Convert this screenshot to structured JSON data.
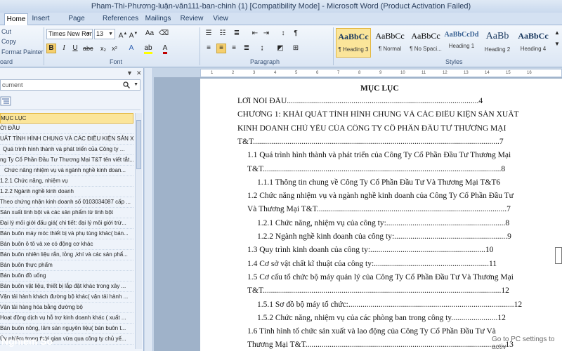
{
  "window": {
    "title": "Pham-Thi-Phương-luận-văn111-ban-chinh (1) [Compatibility Mode]  -  Microsoft Word (Product Activation Failed)"
  },
  "tabs": [
    "Home",
    "Insert",
    "Page Layout",
    "References",
    "Mailings",
    "Review",
    "View"
  ],
  "ribbon": {
    "clipboard": {
      "cut": "Cut",
      "copy": "Copy",
      "format_painter": "Format Painter",
      "label": "oard"
    },
    "font": {
      "name": "Times New Roma",
      "size": "13",
      "label": "Font"
    },
    "paragraph": {
      "label": "Paragraph"
    },
    "styles": {
      "label": "Styles",
      "items": [
        {
          "preview": "AaBbCc",
          "name": "¶ Heading 3"
        },
        {
          "preview": "AaBbCc",
          "name": "¶ Normal"
        },
        {
          "preview": "AaBbCc",
          "name": "¶ No Spaci..."
        },
        {
          "preview": "AaBbCcDd",
          "name": "Heading 1"
        },
        {
          "preview": "AaBb",
          "name": "Heading 2"
        },
        {
          "preview": "AaBbCc",
          "name": "Heading 4"
        }
      ]
    }
  },
  "nav": {
    "search_placeholder": "cument",
    "items": [
      "MỤC LỤC",
      "ỜI ĐẦU",
      "UẤT TÌNH HÌNH CHUNG VÀ CÁC ĐIỀU KIỆN SẢN X...",
      "Quá trình hình thành và phát triển của Công ty ...",
      "ng Ty Cổ Phần Đầu Tư Thương Mại T&T tên viết tắt...",
      "Chức năng nhiệm vụ và ngành nghề kinh doan...",
      "1.2.1 Chức năng, nhiệm vụ",
      "1.2.2 Ngành nghề kinh doanh",
      "Theo chứng nhận kinh doanh số 0103034087 cấp ...",
      "Sản xuất tinh bột và các sản phẩm từ tinh bột",
      "Đại lý mối giới đấu giá( chi tiết: đại lý môi giới trừ...",
      "Bán buôn máy móc thiết bị và phụ tùng khác( bán...",
      "Bán buôn ô tô và xe có động cơ khác",
      "Bán buôn nhiên liệu rắn, lỏng ,khí và các sản phẩ...",
      "Bán buôn thực phẩm",
      "Bán buôn đồ uống",
      "Bán buôn vật liệu, thiết bị lắp đặt khác trong xây ...",
      "Vận tải hành khách đường bộ khác( vận tải hành ...",
      "Vận tải hàng hóa bằng đường bộ",
      "Hoạt động dịch vụ hỗ trợ kinh doanh khác ( xuất ...",
      "Bán buôn nông, lâm sản nguyên liệu( bán buôn t...",
      "Ủy nhiệm trong thời gian vừa qua công ty chủ yế..."
    ]
  },
  "document": {
    "toc_title": "MỤC LỤC",
    "lines": [
      "LỜI NÓI ĐẦU...............................................................................................4",
      "CHƯƠNG 1: KHÁI QUÁT TÌNH HÌNH CHUNG VÀ CÁC ĐIỀU KIỆN SẢN XUẤT",
      "KINH DOANH CHỦ YẾU CỦA CÔNG TY CỔ PHẦN ĐẦU TƯ THƯƠNG MẠI",
      "T&T..........................................................................................................................7",
      "1.1 Quá trình hình thành và phát triển của Công Ty Cổ Phần Đầu Tư Thương Mại",
      "T&T......................................................................................................................8",
      "1.1.1  Thông tin chung về Công Ty Cổ Phần Đầu Tư Và Thương Mại T&T6",
      "1.2 Chức năng nhiệm vụ và ngành nghề kinh doanh của Công Ty Cổ Phần Đầu Tư",
      "Và Thương Mại T&T..............................................................................................7",
      "1.2.1  Chức năng, nhiệm vụ của công ty:...........................................................8",
      "1.2.2 Ngành nghề kinh doanh của công ty:........................................................9",
      "1.3 Quy trình kinh doanh của công ty:.........................................................10",
      "1.4 Cơ sở vật chất kĩ thuật của công ty:.........................................................11",
      "1.5 Cơ cấu tổ chức bộ máy quản lý của Công Ty Cổ  Phần Đầu Tư Và Thương Mại",
      "T&T......................................................................................................................12",
      "1.5.1  Sơ đồ bộ máy tổ chức:..................................................................................12",
      "1.5.2 Chức năng, nhiệm vụ của các phòng ban trong công ty.......................12",
      "1.6 Tình hình tổ chức sản xuất và lao động của Công Ty Cổ Phần Đầu Tư Và",
      "Thương Mại T&T...................................................................................................13"
    ]
  },
  "overlay": {
    "watermark": "Nghiem So",
    "activation": "Go to PC settings to activ"
  },
  "ruler_ticks": [
    "1",
    "2",
    "3",
    "4",
    "5",
    "6",
    "7",
    "8",
    "9",
    "10",
    "11",
    "12",
    "13",
    "14",
    "15",
    "16"
  ]
}
